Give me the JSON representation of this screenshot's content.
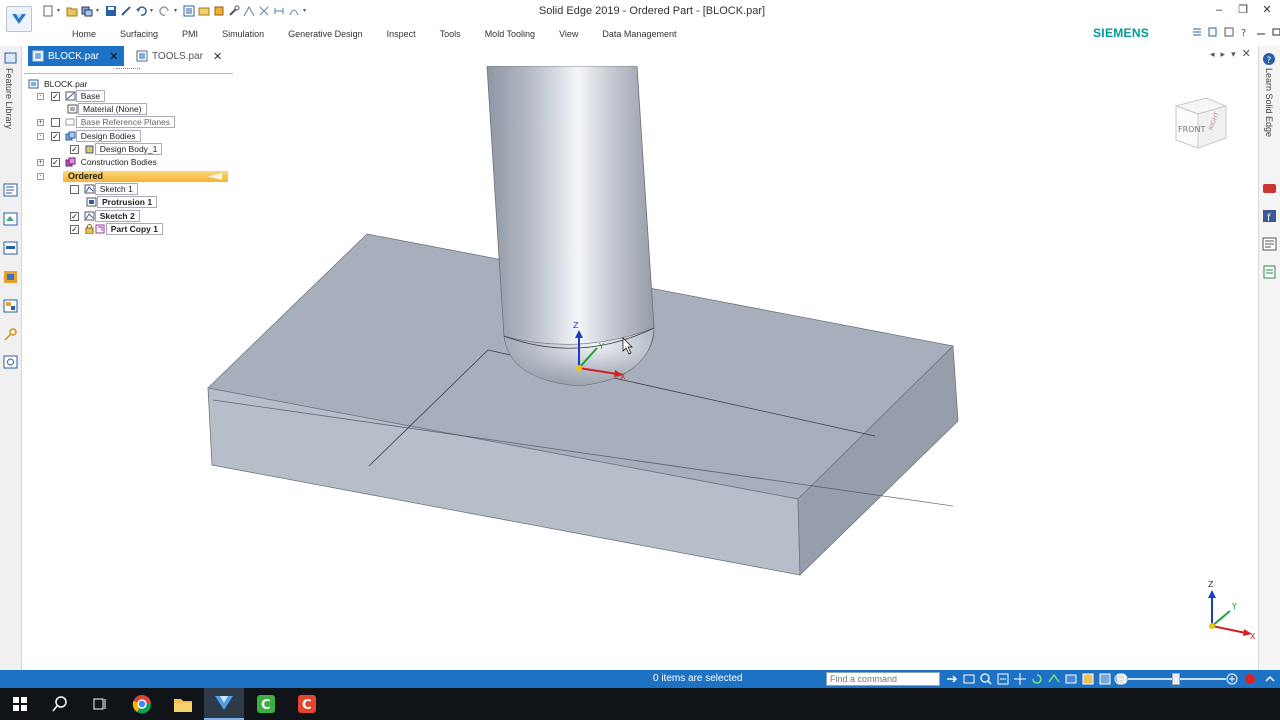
{
  "window": {
    "title": "Solid Edge 2019 - Ordered Part - [BLOCK.par]",
    "brand": "SIEMENS"
  },
  "ribbon": {
    "tabs": [
      "Home",
      "Surfacing",
      "PMI",
      "Simulation",
      "Generative Design",
      "Inspect",
      "Tools",
      "Mold Tooling",
      "View",
      "Data Management"
    ]
  },
  "doc_tabs": [
    {
      "label": "BLOCK.par",
      "active": true
    },
    {
      "label": "TOOLS.par",
      "active": false
    }
  ],
  "side_panels": {
    "left_label": "Feature Library",
    "right_label": "Learn Solid Edge"
  },
  "pathfinder": {
    "root": "BLOCK.par",
    "items": [
      {
        "label": "Base",
        "checked": true,
        "expand": "-"
      },
      {
        "label": "Material (None)"
      },
      {
        "label": "Base Reference Planes",
        "checked": false,
        "expand": "+"
      },
      {
        "label": "Design Bodies",
        "checked": true,
        "expand": "-"
      },
      {
        "label": "Design Body_1",
        "checked": true
      },
      {
        "label": "Construction Bodies",
        "checked": true,
        "expand": "+"
      },
      {
        "label": "Ordered",
        "expand": "-"
      },
      {
        "label": "Sketch 1",
        "checked": false
      },
      {
        "label": "Protrusion 1"
      },
      {
        "label": "Sketch 2",
        "checked": true
      },
      {
        "label": "Part Copy 1",
        "checked": true
      }
    ]
  },
  "viewport": {
    "view_cube_face": "FRONT",
    "axis_labels": {
      "x": "X",
      "y": "Y",
      "z": "Z"
    }
  },
  "status": {
    "selection_text": "0 items are selected",
    "command_placeholder": "Find a command"
  },
  "colors": {
    "accent": "#1e72c4",
    "ordered_highlight": "#f5b433",
    "body_top": "#a6aebb",
    "body_side": "#b7bfcb"
  }
}
